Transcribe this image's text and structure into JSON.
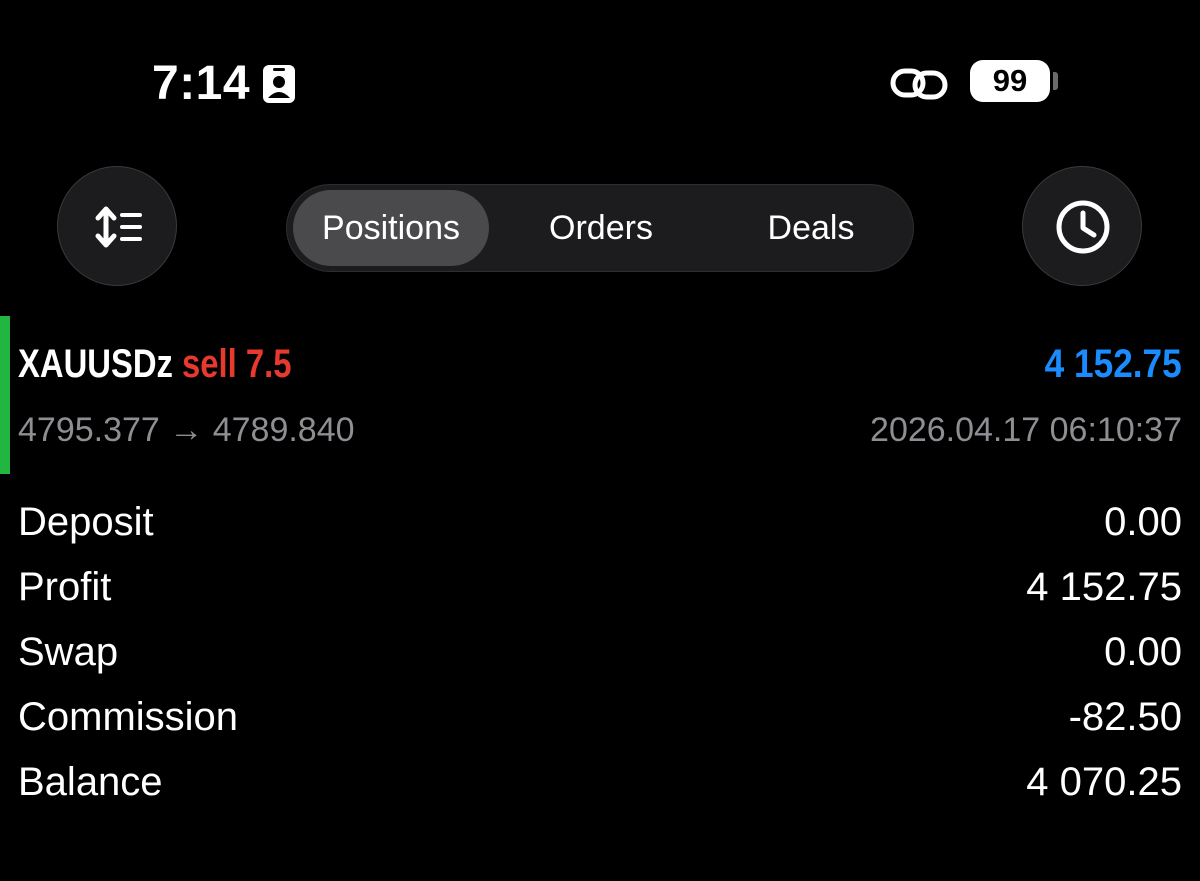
{
  "status_bar": {
    "time": "7:14",
    "battery_level": "99",
    "icons": [
      "contact-card-icon",
      "link-icon",
      "battery-icon"
    ]
  },
  "toolbar": {
    "sort_icon": "sort-list-icon",
    "history_icon": "clock-icon",
    "tabs": [
      {
        "label": "Positions",
        "active": true
      },
      {
        "label": "Orders",
        "active": false
      },
      {
        "label": "Deals",
        "active": false
      }
    ]
  },
  "position": {
    "symbol": "XAUUSDz",
    "direction": "sell 7.5",
    "profit": "4 152.75",
    "open_price": "4795.377",
    "arrow": "→",
    "current_price": "4789.840",
    "open_time": "2026.04.17 06:10:37",
    "colors": {
      "indicator": "#22b540",
      "direction": "#e8392f",
      "profit": "#1a8cff"
    }
  },
  "summary": [
    {
      "label": "Deposit",
      "value": "0.00"
    },
    {
      "label": "Profit",
      "value": "4 152.75"
    },
    {
      "label": "Swap",
      "value": "0.00"
    },
    {
      "label": "Commission",
      "value": "-82.50"
    },
    {
      "label": "Balance",
      "value": "4 070.25"
    }
  ]
}
